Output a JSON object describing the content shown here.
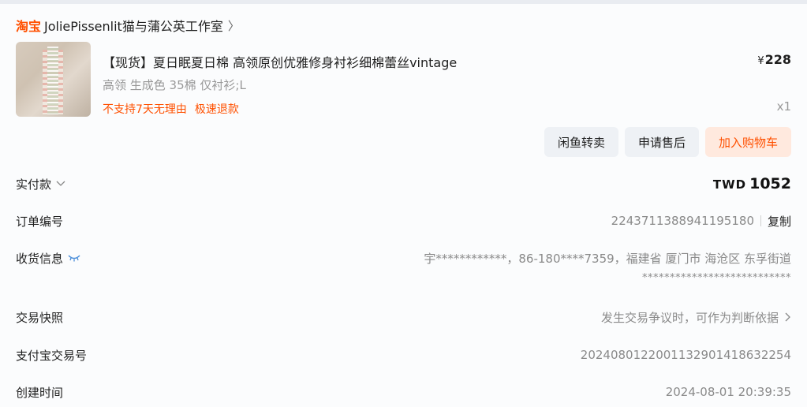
{
  "shop": {
    "brand": "淘宝",
    "name": "JoliePissenlit猫与蒲公英工作室",
    "chevron": "〉"
  },
  "product": {
    "title": "【现货】夏日眠夏日棉 高领原创优雅修身衬衫细棉蕾丝vintage",
    "spec": "高领 生成色 35棉 仅衬衫;L",
    "policy_tags": [
      "不支持7天无理由",
      "极速退款"
    ],
    "currency_symbol": "¥",
    "price": "228",
    "quantity": "x1"
  },
  "actions": {
    "resell": "闲鱼转卖",
    "after_sale": "申请售后",
    "add_to_cart": "加入购物车"
  },
  "order": {
    "paid_label": "实付款",
    "paid_currency": "TWD",
    "paid_amount": "1052",
    "order_no_label": "订单编号",
    "order_no": "2243711388941195180",
    "copy_label": "复制",
    "recipient_label": "收货信息",
    "recipient_line1": "宇************，86-180****7359，福建省 厦门市 海沧区 东孚街道",
    "recipient_line2": "***************************",
    "snapshot_label": "交易快照",
    "snapshot_value": "发生交易争议时，可作为判断依据",
    "alipay_label": "支付宝交易号",
    "alipay_no": "2024080122001132901418632254",
    "created_label": "创建时间",
    "created_time": "2024-08-01 20:39:35"
  },
  "colors": {
    "accent": "#ff5000",
    "muted": "#999999",
    "button_bg": "#eef1f5",
    "cart_bg": "#ffe9de"
  },
  "icons": {
    "dropdown": "chevron-down-icon",
    "visibility": "eye-closed-icon",
    "snapshot_arrow": "chevron-right-icon"
  }
}
